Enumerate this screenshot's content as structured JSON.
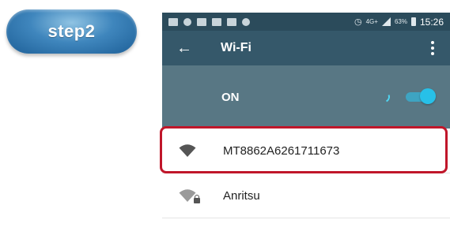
{
  "step_badge": {
    "label": "step2"
  },
  "status_bar": {
    "small_text": "4G+",
    "battery_percent": "63%",
    "time": "15:26"
  },
  "toolbar": {
    "title": "Wi-Fi"
  },
  "wifi_switch": {
    "label": "ON",
    "state": "on"
  },
  "networks": [
    {
      "ssid": "MT8862A6261711673",
      "secured": false,
      "highlighted": true
    },
    {
      "ssid": "Anritsu",
      "secured": true,
      "highlighted": false
    }
  ],
  "colors": {
    "badge": "#3f86bd",
    "status_bar": "#2b4b5b",
    "toolbar": "#35586a",
    "switch_row": "#587784",
    "toggle_accent": "#27c0e8",
    "highlight_frame": "#c0162a"
  },
  "icons": [
    "back-arrow-icon",
    "overflow-menu-icon",
    "wifi-icon",
    "wifi-lock-icon"
  ]
}
